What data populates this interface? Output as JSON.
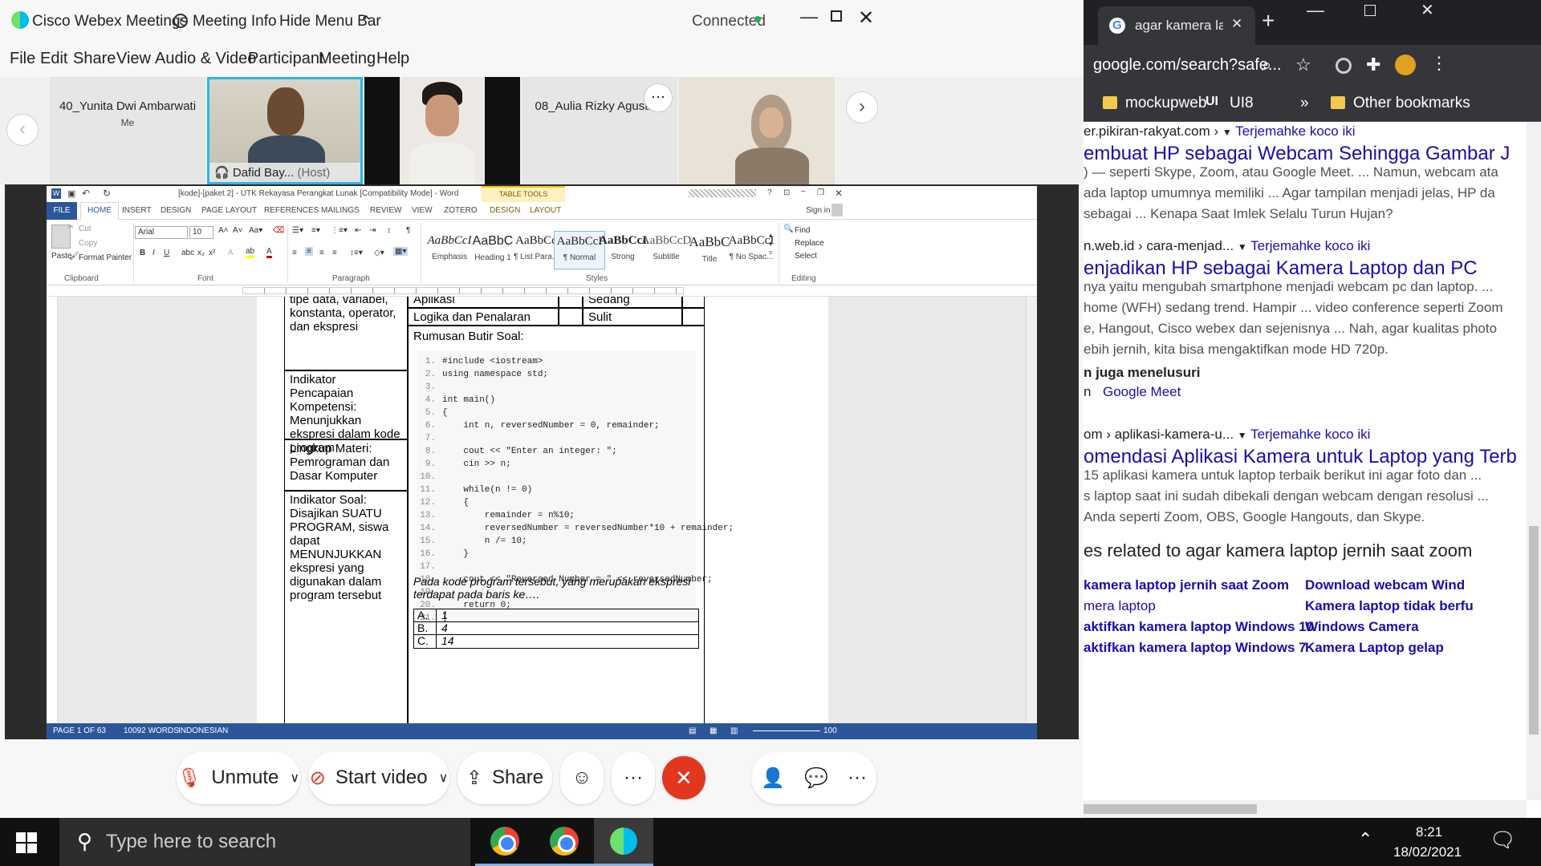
{
  "webex": {
    "title": "Cisco Webex Meetings",
    "meeting_info": "Meeting Info",
    "hide_menu_bar": "Hide Menu Bar",
    "status": "Connected",
    "status_color": "#2bab51",
    "menu": [
      "File",
      "Edit",
      "Share",
      "View",
      "Audio & Video",
      "Participant",
      "Meeting",
      "Help"
    ],
    "participants": [
      {
        "name": "40_Yunita Dwi Ambarwati",
        "sub": "Me"
      },
      {
        "name": "Dafid Bay...",
        "sub": "(Host)"
      },
      {
        "name": "",
        "sub": ""
      },
      {
        "name": "08_Aulia Rizky Agustine",
        "sub": ""
      },
      {
        "name": "",
        "sub": ""
      }
    ],
    "controls": {
      "unmute": "Unmute",
      "start_video": "Start video",
      "share": "Share",
      "more": "···",
      "end_color": "#e2361f"
    }
  },
  "word": {
    "title": "[kode]-[paket 2] - UTK Rekayasa Perangkat Lunak [Compatibility Mode] - Word",
    "table_tools": "TABLE TOOLS",
    "tabs": [
      "FILE",
      "HOME",
      "INSERT",
      "DESIGN",
      "PAGE LAYOUT",
      "REFERENCES",
      "MAILINGS",
      "REVIEW",
      "VIEW",
      "ZOTERO",
      "DESIGN",
      "LAYOUT"
    ],
    "sign_in": "Sign in",
    "clipboard": {
      "paste": "Paste",
      "cut": "Cut",
      "copy": "Copy",
      "format_painter": "Format Painter",
      "label": "Clipboard"
    },
    "font": {
      "name": "Arial",
      "size": "10",
      "label": "Font"
    },
    "paragraph_label": "Paragraph",
    "styles_label": "Styles",
    "editing": {
      "find": "Find",
      "replace": "Replace",
      "select": "Select",
      "label": "Editing"
    },
    "styles": [
      {
        "sample": "AaBbCcI",
        "name": "Emphasis"
      },
      {
        "sample": "AaBbC",
        "name": "Heading 1"
      },
      {
        "sample": "AaBbCc",
        "name": "¶ List Para..."
      },
      {
        "sample": "AaBbCcI",
        "name": "¶ Normal"
      },
      {
        "sample": "AaBbCcI",
        "name": "Strong"
      },
      {
        "sample": "AaBbCcD",
        "name": "Subtitle"
      },
      {
        "sample": "AaBbC",
        "name": "Title"
      },
      {
        "sample": "AaBbCcI",
        "name": "¶ No Spac..."
      }
    ],
    "status": {
      "page": "PAGE 1 OF 63",
      "words": "10092 WORDS",
      "lang": "INDONESIAN",
      "zoom": "100"
    },
    "doc": {
      "left_cells": [
        "tipe data, variabel, konstanta, operator, dan ekspresi",
        "Indikator Pencapaian Kompetensi:\nMenunjukkan ekspresi dalam kode program",
        "Lingkup Materi:\nPemrograman dan Dasar Komputer",
        "Indikator Soal:\nDisajikan SUATU PROGRAM, siswa dapat MENUNJUKKAN ekspresi yang digunakan dalam program tersebut"
      ],
      "row_a": {
        "c1": "Aplikasi",
        "c2": "Sedang"
      },
      "row_b": {
        "c1": "Logika dan Penalaran",
        "c2": "Sulit"
      },
      "rumusan": "Rumusan Butir Soal:",
      "question": "Pada kode program tersebut, yang merupakan ekspresi terdapat pada baris ke….",
      "options": [
        {
          "label": "A.",
          "value": "1"
        },
        {
          "label": "B.",
          "value": "4"
        },
        {
          "label": "C.",
          "value": "14"
        }
      ],
      "code": [
        "#include <iostream>",
        "using namespace std;",
        "",
        "int main()",
        "{",
        "    int n, reversedNumber = 0, remainder;",
        "",
        "    cout << \"Enter an integer: \";",
        "    cin >> n;",
        "",
        "    while(n != 0)",
        "    {",
        "        remainder = n%10;",
        "        reversedNumber = reversedNumber*10 + remainder;",
        "        n /= 10;",
        "    }",
        "",
        "    cout << \"Reversed Number = \" << reversedNumber;",
        "",
        "    return 0;",
        "}"
      ]
    }
  },
  "chrome": {
    "tab_title": "agar kamera la",
    "address": "google.com/search?safe...",
    "bookmarks": [
      "mockupweb",
      "UI8",
      "»",
      "Other bookmarks"
    ],
    "results": [
      {
        "crumb": "er.pikiran-rakyat.com ›",
        "translate": "Terjemahke koco iki",
        "title": "embuat HP sebagai Webcam Sehingga Gambar J",
        "snippet": [
          ") — seperti Skype, Zoom, atau Google Meet. ... Namun, webcam ata",
          "ada laptop umumnya memiliki ... Agar tampilan menjadi jelas, HP da",
          "sebagai ... Kenapa Saat Imlek Selalu Turun Hujan?"
        ]
      },
      {
        "crumb": "n.web.id › cara-menjad...",
        "translate": "Terjemahke koco iki",
        "title": "enjadikan HP sebagai Kamera Laptop dan PC",
        "snippet": [
          "nya yaitu mengubah smartphone menjadi webcam pc dan laptop. ...",
          "home (WFH) sedang trend. Hampir ... video conference seperti Zoom",
          "e, Hangout, Cisco webex dan sejenisnya ... Nah, agar kualitas photo",
          "ebih jernih, kita bisa mengaktifkan mode HD 720p."
        ]
      },
      {
        "crumb": "om › aplikasi-kamera-u...",
        "translate": "Terjemahke koco iki",
        "title": "omendasi Aplikasi Kamera untuk Laptop yang Terb",
        "snippet": [
          "15 aplikasi kamera untuk laptop terbaik berikut ini agar foto dan ...",
          "s laptop saat ini sudah dibekali dengan webcam dengan resolusi ...",
          "Anda seperti Zoom, OBS, Google Hangouts, dan Skype."
        ]
      }
    ],
    "also_search": "n juga menelusuri",
    "also_item": "Google Meet",
    "also_prefix": "n",
    "related_title": "es related to agar kamera laptop jernih saat zoom",
    "related": [
      [
        "kamera laptop jernih saat Zoom",
        "Download webcam Wind"
      ],
      [
        "mera laptop",
        "Kamera laptop tidak berfu"
      ],
      [
        "aktifkan kamera laptop Windows 10",
        "Windows Camera"
      ],
      [
        "aktifkan kamera laptop Windows 7",
        "Kamera Laptop gelap"
      ]
    ]
  },
  "taskbar": {
    "search_placeholder": "Type here to search",
    "time": "8:21",
    "date": "18/02/2021"
  }
}
